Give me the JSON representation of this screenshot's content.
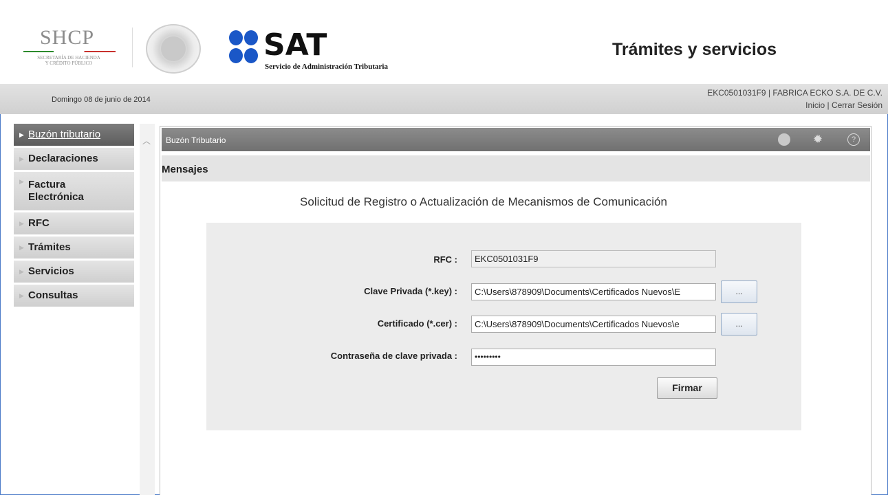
{
  "header": {
    "shcp_logo": "SHCP",
    "shcp_sub1": "SECRETARÍA DE HACIENDA",
    "shcp_sub2": "Y CRÉDITO PÚBLICO",
    "sat_logo": "SAT",
    "sat_subtitle": "Servicio de Administración Tributaria",
    "title": "Trámites y servicios"
  },
  "infobar": {
    "date": "Domingo 08 de junio de 2014",
    "user": "EKC0501031F9 | FABRICA ECKO S.A. DE C.V.",
    "inicio": "Inicio",
    "separator": " | ",
    "cerrar": "Cerrar Sesión"
  },
  "sidebar": {
    "items": [
      {
        "label": "Buzón tributario",
        "active": true
      },
      {
        "label": "Declaraciones"
      },
      {
        "label": "Factura\nElectrónica"
      },
      {
        "label": "RFC"
      },
      {
        "label": "Trámites"
      },
      {
        "label": "Servicios"
      },
      {
        "label": "Consultas"
      }
    ]
  },
  "panel": {
    "title": "Buzón Tributario",
    "section": "Mensajes",
    "form_title": "Solicitud de Registro o Actualización de Mecanismos de Comunicación",
    "help_glyph": "?",
    "gear_glyph": "✹"
  },
  "form": {
    "rfc_label": "RFC :",
    "rfc_value": "EKC0501031F9",
    "key_label": "Clave Privada (*.key) :",
    "key_value": "C:\\Users\\878909\\Documents\\Certificados Nuevos\\E",
    "cer_label": "Certificado (*.cer) :",
    "cer_value": "C:\\Users\\878909\\Documents\\Certificados Nuevos\\e",
    "pwd_label": "Contraseña de clave privada :",
    "pwd_value": "•••••••••",
    "browse_label": "...",
    "submit_label": "Firmar"
  },
  "colors": {
    "sat_blue": "#1a57c7",
    "sidebar_active": "#666666",
    "panel_bar": "#7d7d7d"
  }
}
